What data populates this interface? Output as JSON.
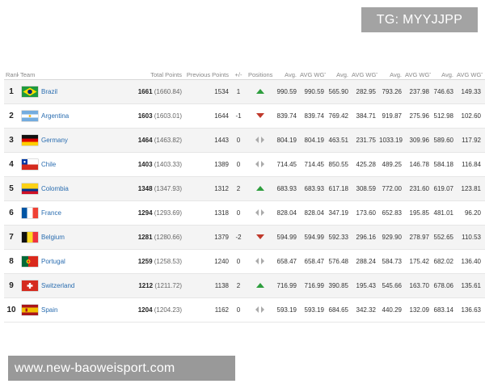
{
  "watermarks": {
    "top": "TG: MYYJJPP",
    "bottom": "www.new-baoweisport.com"
  },
  "table": {
    "headers": {
      "rank": "Rank",
      "team": "Team",
      "total_points": "Total Points",
      "previous_points": "Previous Points",
      "plus_minus": "+/-",
      "positions": "Positions",
      "avg1": "Avg.",
      "avg_wgt1": "AVG WGT",
      "avg2": "Avg.",
      "avg_wgt2": "AVG WGT",
      "avg3": "Avg.",
      "avg_wgt3": "AVG WGT",
      "avg4": "Avg.",
      "avg_wgt4": "AVG WGT"
    },
    "rows": [
      {
        "rank": "1",
        "team": "Brazil",
        "flag": "flag-brazil",
        "points": "1661",
        "points_exact": "(1660.84)",
        "previous": "1534",
        "change": "1",
        "trend": "up",
        "a1": "990.59",
        "w1": "990.59",
        "a2": "565.90",
        "w2": "282.95",
        "a3": "793.26",
        "w3": "237.98",
        "a4": "746.63",
        "w4": "149.33"
      },
      {
        "rank": "2",
        "team": "Argentina",
        "flag": "flag-argentina",
        "points": "1603",
        "points_exact": "(1603.01)",
        "previous": "1644",
        "change": "-1",
        "trend": "down",
        "a1": "839.74",
        "w1": "839.74",
        "a2": "769.42",
        "w2": "384.71",
        "a3": "919.87",
        "w3": "275.96",
        "a4": "512.98",
        "w4": "102.60"
      },
      {
        "rank": "3",
        "team": "Germany",
        "flag": "flag-germany",
        "points": "1464",
        "points_exact": "(1463.82)",
        "previous": "1443",
        "change": "0",
        "trend": "same",
        "a1": "804.19",
        "w1": "804.19",
        "a2": "463.51",
        "w2": "231.75",
        "a3": "1033.19",
        "w3": "309.96",
        "a4": "589.60",
        "w4": "117.92"
      },
      {
        "rank": "4",
        "team": "Chile",
        "flag": "flag-chile",
        "points": "1403",
        "points_exact": "(1403.33)",
        "previous": "1389",
        "change": "0",
        "trend": "same",
        "a1": "714.45",
        "w1": "714.45",
        "a2": "850.55",
        "w2": "425.28",
        "a3": "489.25",
        "w3": "146.78",
        "a4": "584.18",
        "w4": "116.84"
      },
      {
        "rank": "5",
        "team": "Colombia",
        "flag": "flag-colombia",
        "points": "1348",
        "points_exact": "(1347.93)",
        "previous": "1312",
        "change": "2",
        "trend": "up",
        "a1": "683.93",
        "w1": "683.93",
        "a2": "617.18",
        "w2": "308.59",
        "a3": "772.00",
        "w3": "231.60",
        "a4": "619.07",
        "w4": "123.81"
      },
      {
        "rank": "6",
        "team": "France",
        "flag": "flag-france",
        "points": "1294",
        "points_exact": "(1293.69)",
        "previous": "1318",
        "change": "0",
        "trend": "same",
        "a1": "828.04",
        "w1": "828.04",
        "a2": "347.19",
        "w2": "173.60",
        "a3": "652.83",
        "w3": "195.85",
        "a4": "481.01",
        "w4": "96.20"
      },
      {
        "rank": "7",
        "team": "Belgium",
        "flag": "flag-belgium",
        "points": "1281",
        "points_exact": "(1280.66)",
        "previous": "1379",
        "change": "-2",
        "trend": "down",
        "a1": "594.99",
        "w1": "594.99",
        "a2": "592.33",
        "w2": "296.16",
        "a3": "929.90",
        "w3": "278.97",
        "a4": "552.65",
        "w4": "110.53"
      },
      {
        "rank": "8",
        "team": "Portugal",
        "flag": "flag-portugal",
        "points": "1259",
        "points_exact": "(1258.53)",
        "previous": "1240",
        "change": "0",
        "trend": "same",
        "a1": "658.47",
        "w1": "658.47",
        "a2": "576.48",
        "w2": "288.24",
        "a3": "584.73",
        "w3": "175.42",
        "a4": "682.02",
        "w4": "136.40"
      },
      {
        "rank": "9",
        "team": "Switzerland",
        "flag": "flag-switzerland",
        "points": "1212",
        "points_exact": "(1211.72)",
        "previous": "1138",
        "change": "2",
        "trend": "up",
        "a1": "716.99",
        "w1": "716.99",
        "a2": "390.85",
        "w2": "195.43",
        "a3": "545.66",
        "w3": "163.70",
        "a4": "678.06",
        "w4": "135.61"
      },
      {
        "rank": "10",
        "team": "Spain",
        "flag": "flag-spain",
        "points": "1204",
        "points_exact": "(1204.23)",
        "previous": "1162",
        "change": "0",
        "trend": "same",
        "a1": "593.19",
        "w1": "593.19",
        "a2": "684.65",
        "w2": "342.32",
        "a3": "440.29",
        "w3": "132.09",
        "a4": "683.14",
        "w4": "136.63"
      }
    ]
  },
  "colors": {
    "link": "#2a6db0",
    "up": "#2e9e3e",
    "down": "#c0392b",
    "same": "#aaaaaa",
    "expand": "#2a8ad8"
  },
  "icons": {
    "expand": "chevron-down-icon",
    "up": "arrow-up-icon",
    "down": "arrow-down-icon",
    "same": "no-change-icon"
  }
}
